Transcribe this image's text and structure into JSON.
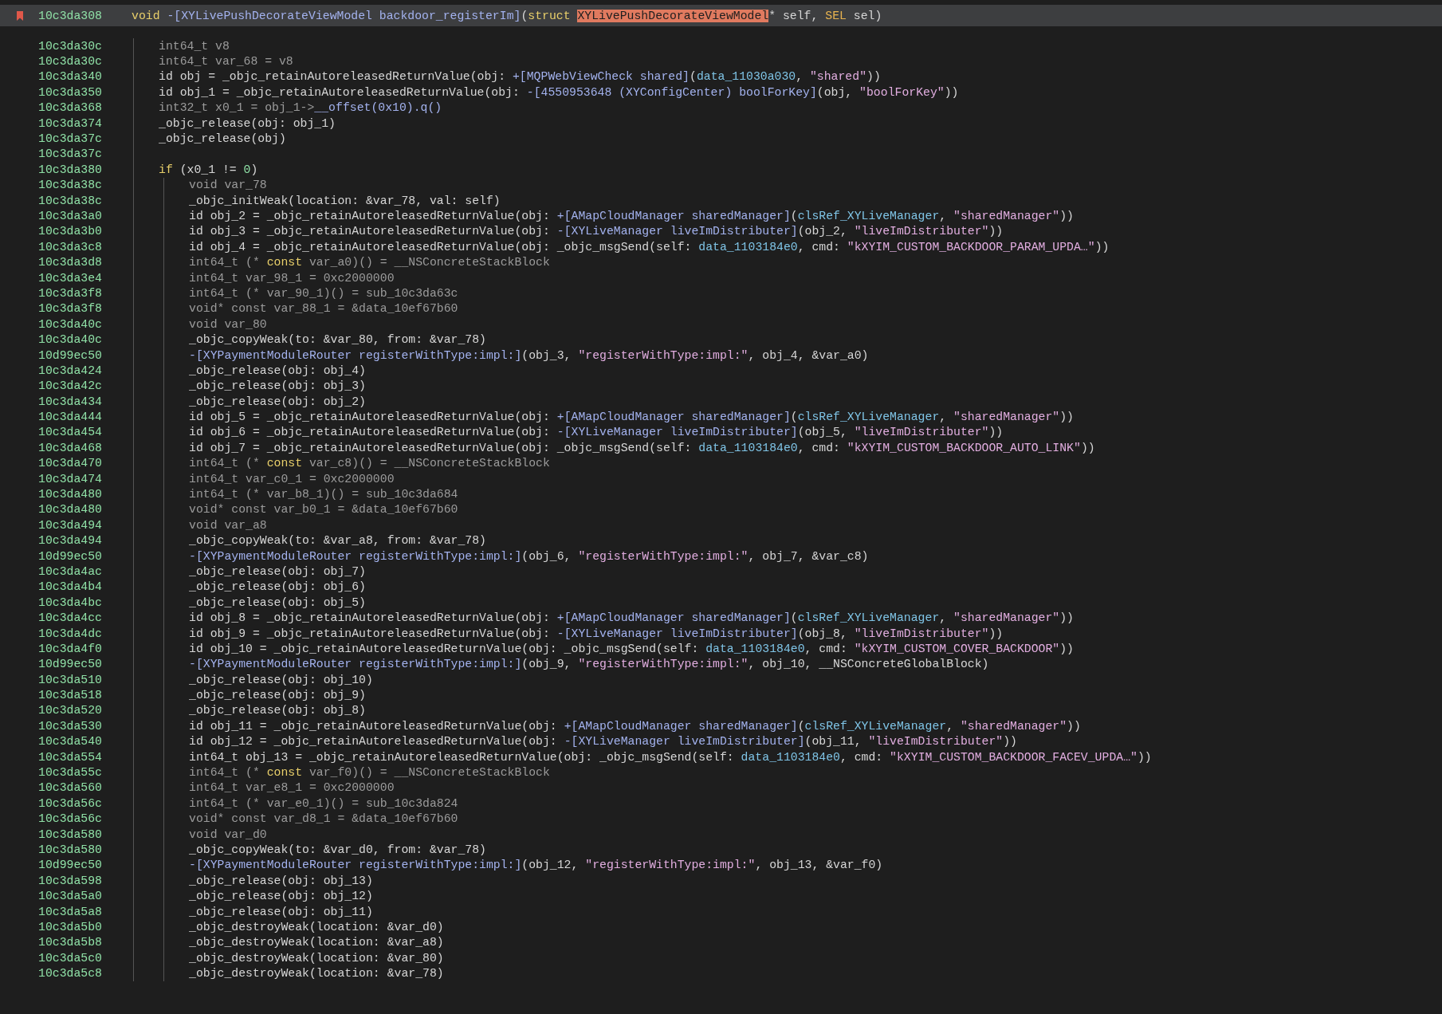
{
  "header": {
    "bookmarked": true,
    "address": "10c3da308",
    "signature": [
      {
        "kind": "keyword",
        "text": "void"
      },
      {
        "kind": "method",
        "text": " -[XYLivePushDecorateViewModel backdoor_registerIm]"
      },
      {
        "kind": "plain",
        "text": "("
      },
      {
        "kind": "keyword",
        "text": "struct "
      },
      {
        "kind": "highlight",
        "text": "XYLivePushDecorateViewModel"
      },
      {
        "kind": "plain",
        "text": "* self, "
      },
      {
        "kind": "type",
        "text": "SEL"
      },
      {
        "kind": "plain",
        "text": " sel)"
      }
    ]
  },
  "lines": [
    {
      "address": "10c3da30c",
      "dimmed": true,
      "code": [
        {
          "kind": "plain",
          "text": "int64_t v8"
        }
      ]
    },
    {
      "address": "10c3da30c",
      "dimmed": true,
      "code": [
        {
          "kind": "plain",
          "text": "int64_t var_68 = v8"
        }
      ]
    },
    {
      "address": "10c3da340",
      "dimmed": false,
      "code": [
        {
          "kind": "plain",
          "text": "id obj = _objc_retainAutoreleasedReturnValue(obj: "
        },
        {
          "kind": "method",
          "text": "+[MQPWebViewCheck shared]"
        },
        {
          "kind": "plain",
          "text": "("
        },
        {
          "kind": "data",
          "text": "data_11030a030"
        },
        {
          "kind": "plain",
          "text": ", "
        },
        {
          "kind": "string",
          "text": "\"shared\""
        },
        {
          "kind": "plain",
          "text": "))"
        }
      ]
    },
    {
      "address": "10c3da350",
      "dimmed": false,
      "code": [
        {
          "kind": "plain",
          "text": "id obj_1 = _objc_retainAutoreleasedReturnValue(obj: "
        },
        {
          "kind": "method",
          "text": "-[4550953648 (XYConfigCenter) boolForKey]"
        },
        {
          "kind": "plain",
          "text": "(obj, "
        },
        {
          "kind": "string",
          "text": "\"boolForKey\""
        },
        {
          "kind": "plain",
          "text": "))"
        }
      ]
    },
    {
      "address": "10c3da368",
      "dimmed": true,
      "code": [
        {
          "kind": "plain",
          "text": "int32_t x0_1 = obj_1->"
        },
        {
          "kind": "method",
          "text": "__offset(0x10).q()"
        }
      ]
    },
    {
      "address": "10c3da374",
      "dimmed": false,
      "code": [
        {
          "kind": "plain",
          "text": "_objc_release(obj: obj_1)"
        }
      ]
    },
    {
      "address": "10c3da37c",
      "dimmed": false,
      "code": [
        {
          "kind": "plain",
          "text": "_objc_release(obj)"
        }
      ]
    },
    {
      "address": "10c3da37c"
    },
    {
      "address": "10c3da380",
      "dimmed": false,
      "code": [
        {
          "kind": "keyword",
          "text": "if"
        },
        {
          "kind": "plain",
          "text": " (x0_1 != "
        },
        {
          "kind": "number",
          "text": "0"
        },
        {
          "kind": "plain",
          "text": ")"
        }
      ],
      "children": [
        {
          "address": "10c3da38c",
          "dimmed": true,
          "code": [
            {
              "kind": "plain",
              "text": "void var_78"
            }
          ]
        },
        {
          "address": "10c3da38c",
          "dimmed": false,
          "code": [
            {
              "kind": "plain",
              "text": "_objc_initWeak(location: &var_78, val: self)"
            }
          ]
        },
        {
          "address": "10c3da3a0",
          "dimmed": false,
          "code": [
            {
              "kind": "plain",
              "text": "id obj_2 = _objc_retainAutoreleasedReturnValue(obj: "
            },
            {
              "kind": "method",
              "text": "+[AMapCloudManager sharedManager]"
            },
            {
              "kind": "plain",
              "text": "("
            },
            {
              "kind": "data",
              "text": "clsRef_XYLiveManager"
            },
            {
              "kind": "plain",
              "text": ", "
            },
            {
              "kind": "string",
              "text": "\"sharedManager\""
            },
            {
              "kind": "plain",
              "text": "))"
            }
          ]
        },
        {
          "address": "10c3da3b0",
          "dimmed": false,
          "code": [
            {
              "kind": "plain",
              "text": "id obj_3 = _objc_retainAutoreleasedReturnValue(obj: "
            },
            {
              "kind": "method",
              "text": "-[XYLiveManager liveImDistributer]"
            },
            {
              "kind": "plain",
              "text": "(obj_2, "
            },
            {
              "kind": "string",
              "text": "\"liveImDistributer\""
            },
            {
              "kind": "plain",
              "text": "))"
            }
          ]
        },
        {
          "address": "10c3da3c8",
          "dimmed": false,
          "code": [
            {
              "kind": "plain",
              "text": "id obj_4 = _objc_retainAutoreleasedReturnValue(obj: _objc_msgSend(self: "
            },
            {
              "kind": "data",
              "text": "data_1103184e0"
            },
            {
              "kind": "plain",
              "text": ", cmd: "
            },
            {
              "kind": "string",
              "text": "\"kXYIM_CUSTOM_BACKDOOR_PARAM_UPDA…\""
            },
            {
              "kind": "plain",
              "text": "))"
            }
          ]
        },
        {
          "address": "10c3da3d8",
          "dimmed": true,
          "code": [
            {
              "kind": "plain",
              "text": "int64_t (* "
            },
            {
              "kind": "keyword",
              "text": "const"
            },
            {
              "kind": "plain",
              "text": " var_a0)() = __NSConcreteStackBlock"
            }
          ]
        },
        {
          "address": "10c3da3e4",
          "dimmed": true,
          "code": [
            {
              "kind": "plain",
              "text": "int64_t var_98_1 = 0xc2000000"
            }
          ]
        },
        {
          "address": "10c3da3f8",
          "dimmed": true,
          "code": [
            {
              "kind": "plain",
              "text": "int64_t (* var_90_1)() = sub_10c3da63c"
            }
          ]
        },
        {
          "address": "10c3da3f8",
          "dimmed": true,
          "code": [
            {
              "kind": "plain",
              "text": "void* const var_88_1 = &data_10ef67b60"
            }
          ]
        },
        {
          "address": "10c3da40c",
          "dimmed": true,
          "code": [
            {
              "kind": "plain",
              "text": "void var_80"
            }
          ]
        },
        {
          "address": "10c3da40c",
          "dimmed": false,
          "code": [
            {
              "kind": "plain",
              "text": "_objc_copyWeak(to: &var_80, from: &var_78)"
            }
          ]
        },
        {
          "address": "10d99ec50",
          "dimmed": false,
          "code": [
            {
              "kind": "method",
              "text": "-[XYPaymentModuleRouter registerWithType:impl:]"
            },
            {
              "kind": "plain",
              "text": "(obj_3, "
            },
            {
              "kind": "string",
              "text": "\"registerWithType:impl:\""
            },
            {
              "kind": "plain",
              "text": ", obj_4, &var_a0)"
            }
          ]
        },
        {
          "address": "10c3da424",
          "dimmed": false,
          "code": [
            {
              "kind": "plain",
              "text": "_objc_release(obj: obj_4)"
            }
          ]
        },
        {
          "address": "10c3da42c",
          "dimmed": false,
          "code": [
            {
              "kind": "plain",
              "text": "_objc_release(obj: obj_3)"
            }
          ]
        },
        {
          "address": "10c3da434",
          "dimmed": false,
          "code": [
            {
              "kind": "plain",
              "text": "_objc_release(obj: obj_2)"
            }
          ]
        },
        {
          "address": "10c3da444",
          "dimmed": false,
          "code": [
            {
              "kind": "plain",
              "text": "id obj_5 = _objc_retainAutoreleasedReturnValue(obj: "
            },
            {
              "kind": "method",
              "text": "+[AMapCloudManager sharedManager]"
            },
            {
              "kind": "plain",
              "text": "("
            },
            {
              "kind": "data",
              "text": "clsRef_XYLiveManager"
            },
            {
              "kind": "plain",
              "text": ", "
            },
            {
              "kind": "string",
              "text": "\"sharedManager\""
            },
            {
              "kind": "plain",
              "text": "))"
            }
          ]
        },
        {
          "address": "10c3da454",
          "dimmed": false,
          "code": [
            {
              "kind": "plain",
              "text": "id obj_6 = _objc_retainAutoreleasedReturnValue(obj: "
            },
            {
              "kind": "method",
              "text": "-[XYLiveManager liveImDistributer]"
            },
            {
              "kind": "plain",
              "text": "(obj_5, "
            },
            {
              "kind": "string",
              "text": "\"liveImDistributer\""
            },
            {
              "kind": "plain",
              "text": "))"
            }
          ]
        },
        {
          "address": "10c3da468",
          "dimmed": false,
          "code": [
            {
              "kind": "plain",
              "text": "id obj_7 = _objc_retainAutoreleasedReturnValue(obj: _objc_msgSend(self: "
            },
            {
              "kind": "data",
              "text": "data_1103184e0"
            },
            {
              "kind": "plain",
              "text": ", cmd: "
            },
            {
              "kind": "string",
              "text": "\"kXYIM_CUSTOM_BACKDOOR_AUTO_LINK\""
            },
            {
              "kind": "plain",
              "text": "))"
            }
          ]
        },
        {
          "address": "10c3da470",
          "dimmed": true,
          "code": [
            {
              "kind": "plain",
              "text": "int64_t (* "
            },
            {
              "kind": "keyword",
              "text": "const"
            },
            {
              "kind": "plain",
              "text": " var_c8)() = __NSConcreteStackBlock"
            }
          ]
        },
        {
          "address": "10c3da474",
          "dimmed": true,
          "code": [
            {
              "kind": "plain",
              "text": "int64_t var_c0_1 = 0xc2000000"
            }
          ]
        },
        {
          "address": "10c3da480",
          "dimmed": true,
          "code": [
            {
              "kind": "plain",
              "text": "int64_t (* var_b8_1)() = sub_10c3da684"
            }
          ]
        },
        {
          "address": "10c3da480",
          "dimmed": true,
          "code": [
            {
              "kind": "plain",
              "text": "void* const var_b0_1 = &data_10ef67b60"
            }
          ]
        },
        {
          "address": "10c3da494",
          "dimmed": true,
          "code": [
            {
              "kind": "plain",
              "text": "void var_a8"
            }
          ]
        },
        {
          "address": "10c3da494",
          "dimmed": false,
          "code": [
            {
              "kind": "plain",
              "text": "_objc_copyWeak(to: &var_a8, from: &var_78)"
            }
          ]
        },
        {
          "address": "10d99ec50",
          "dimmed": false,
          "code": [
            {
              "kind": "method",
              "text": "-[XYPaymentModuleRouter registerWithType:impl:]"
            },
            {
              "kind": "plain",
              "text": "(obj_6, "
            },
            {
              "kind": "string",
              "text": "\"registerWithType:impl:\""
            },
            {
              "kind": "plain",
              "text": ", obj_7, &var_c8)"
            }
          ]
        },
        {
          "address": "10c3da4ac",
          "dimmed": false,
          "code": [
            {
              "kind": "plain",
              "text": "_objc_release(obj: obj_7)"
            }
          ]
        },
        {
          "address": "10c3da4b4",
          "dimmed": false,
          "code": [
            {
              "kind": "plain",
              "text": "_objc_release(obj: obj_6)"
            }
          ]
        },
        {
          "address": "10c3da4bc",
          "dimmed": false,
          "code": [
            {
              "kind": "plain",
              "text": "_objc_release(obj: obj_5)"
            }
          ]
        },
        {
          "address": "10c3da4cc",
          "dimmed": false,
          "code": [
            {
              "kind": "plain",
              "text": "id obj_8 = _objc_retainAutoreleasedReturnValue(obj: "
            },
            {
              "kind": "method",
              "text": "+[AMapCloudManager sharedManager]"
            },
            {
              "kind": "plain",
              "text": "("
            },
            {
              "kind": "data",
              "text": "clsRef_XYLiveManager"
            },
            {
              "kind": "plain",
              "text": ", "
            },
            {
              "kind": "string",
              "text": "\"sharedManager\""
            },
            {
              "kind": "plain",
              "text": "))"
            }
          ]
        },
        {
          "address": "10c3da4dc",
          "dimmed": false,
          "code": [
            {
              "kind": "plain",
              "text": "id obj_9 = _objc_retainAutoreleasedReturnValue(obj: "
            },
            {
              "kind": "method",
              "text": "-[XYLiveManager liveImDistributer]"
            },
            {
              "kind": "plain",
              "text": "(obj_8, "
            },
            {
              "kind": "string",
              "text": "\"liveImDistributer\""
            },
            {
              "kind": "plain",
              "text": "))"
            }
          ]
        },
        {
          "address": "10c3da4f0",
          "dimmed": false,
          "code": [
            {
              "kind": "plain",
              "text": "id obj_10 = _objc_retainAutoreleasedReturnValue(obj: _objc_msgSend(self: "
            },
            {
              "kind": "data",
              "text": "data_1103184e0"
            },
            {
              "kind": "plain",
              "text": ", cmd: "
            },
            {
              "kind": "string",
              "text": "\"kXYIM_CUSTOM_COVER_BACKDOOR\""
            },
            {
              "kind": "plain",
              "text": "))"
            }
          ]
        },
        {
          "address": "10d99ec50",
          "dimmed": false,
          "code": [
            {
              "kind": "method",
              "text": "-[XYPaymentModuleRouter registerWithType:impl:]"
            },
            {
              "kind": "plain",
              "text": "(obj_9, "
            },
            {
              "kind": "string",
              "text": "\"registerWithType:impl:\""
            },
            {
              "kind": "plain",
              "text": ", obj_10, __NSConcreteGlobalBlock)"
            }
          ]
        },
        {
          "address": "10c3da510",
          "dimmed": false,
          "code": [
            {
              "kind": "plain",
              "text": "_objc_release(obj: obj_10)"
            }
          ]
        },
        {
          "address": "10c3da518",
          "dimmed": false,
          "code": [
            {
              "kind": "plain",
              "text": "_objc_release(obj: obj_9)"
            }
          ]
        },
        {
          "address": "10c3da520",
          "dimmed": false,
          "code": [
            {
              "kind": "plain",
              "text": "_objc_release(obj: obj_8)"
            }
          ]
        },
        {
          "address": "10c3da530",
          "dimmed": false,
          "code": [
            {
              "kind": "plain",
              "text": "id obj_11 = _objc_retainAutoreleasedReturnValue(obj: "
            },
            {
              "kind": "method",
              "text": "+[AMapCloudManager sharedManager]"
            },
            {
              "kind": "plain",
              "text": "("
            },
            {
              "kind": "data",
              "text": "clsRef_XYLiveManager"
            },
            {
              "kind": "plain",
              "text": ", "
            },
            {
              "kind": "string",
              "text": "\"sharedManager\""
            },
            {
              "kind": "plain",
              "text": "))"
            }
          ]
        },
        {
          "address": "10c3da540",
          "dimmed": false,
          "code": [
            {
              "kind": "plain",
              "text": "id obj_12 = _objc_retainAutoreleasedReturnValue(obj: "
            },
            {
              "kind": "method",
              "text": "-[XYLiveManager liveImDistributer]"
            },
            {
              "kind": "plain",
              "text": "(obj_11, "
            },
            {
              "kind": "string",
              "text": "\"liveImDistributer\""
            },
            {
              "kind": "plain",
              "text": "))"
            }
          ]
        },
        {
          "address": "10c3da554",
          "dimmed": false,
          "code": [
            {
              "kind": "plain",
              "text": "int64_t obj_13 = _objc_retainAutoreleasedReturnValue(obj: _objc_msgSend(self: "
            },
            {
              "kind": "data",
              "text": "data_1103184e0"
            },
            {
              "kind": "plain",
              "text": ", cmd: "
            },
            {
              "kind": "string",
              "text": "\"kXYIM_CUSTOM_BACKDOOR_FACEV_UPDA…\""
            },
            {
              "kind": "plain",
              "text": "))"
            }
          ]
        },
        {
          "address": "10c3da55c",
          "dimmed": true,
          "code": [
            {
              "kind": "plain",
              "text": "int64_t (* "
            },
            {
              "kind": "keyword",
              "text": "const"
            },
            {
              "kind": "plain",
              "text": " var_f0)() = __NSConcreteStackBlock"
            }
          ]
        },
        {
          "address": "10c3da560",
          "dimmed": true,
          "code": [
            {
              "kind": "plain",
              "text": "int64_t var_e8_1 = 0xc2000000"
            }
          ]
        },
        {
          "address": "10c3da56c",
          "dimmed": true,
          "code": [
            {
              "kind": "plain",
              "text": "int64_t (* var_e0_1)() = sub_10c3da824"
            }
          ]
        },
        {
          "address": "10c3da56c",
          "dimmed": true,
          "code": [
            {
              "kind": "plain",
              "text": "void* const var_d8_1 = &data_10ef67b60"
            }
          ]
        },
        {
          "address": "10c3da580",
          "dimmed": true,
          "code": [
            {
              "kind": "plain",
              "text": "void var_d0"
            }
          ]
        },
        {
          "address": "10c3da580",
          "dimmed": false,
          "code": [
            {
              "kind": "plain",
              "text": "_objc_copyWeak(to: &var_d0, from: &var_78)"
            }
          ]
        },
        {
          "address": "10d99ec50",
          "dimmed": false,
          "code": [
            {
              "kind": "method",
              "text": "-[XYPaymentModuleRouter registerWithType:impl:]"
            },
            {
              "kind": "plain",
              "text": "(obj_12, "
            },
            {
              "kind": "string",
              "text": "\"registerWithType:impl:\""
            },
            {
              "kind": "plain",
              "text": ", obj_13, &var_f0)"
            }
          ]
        },
        {
          "address": "10c3da598",
          "dimmed": false,
          "code": [
            {
              "kind": "plain",
              "text": "_objc_release(obj: obj_13)"
            }
          ]
        },
        {
          "address": "10c3da5a0",
          "dimmed": false,
          "code": [
            {
              "kind": "plain",
              "text": "_objc_release(obj: obj_12)"
            }
          ]
        },
        {
          "address": "10c3da5a8",
          "dimmed": false,
          "code": [
            {
              "kind": "plain",
              "text": "_objc_release(obj: obj_11)"
            }
          ]
        },
        {
          "address": "10c3da5b0",
          "dimmed": false,
          "code": [
            {
              "kind": "plain",
              "text": "_objc_destroyWeak(location: &var_d0)"
            }
          ]
        },
        {
          "address": "10c3da5b8",
          "dimmed": false,
          "code": [
            {
              "kind": "plain",
              "text": "_objc_destroyWeak(location: &var_a8)"
            }
          ]
        },
        {
          "address": "10c3da5c0",
          "dimmed": false,
          "code": [
            {
              "kind": "plain",
              "text": "_objc_destroyWeak(location: &var_80)"
            }
          ]
        },
        {
          "address": "10c3da5c8",
          "dimmed": false,
          "code": [
            {
              "kind": "plain",
              "text": "_objc_destroyWeak(location: &var_78)"
            }
          ]
        }
      ]
    }
  ]
}
